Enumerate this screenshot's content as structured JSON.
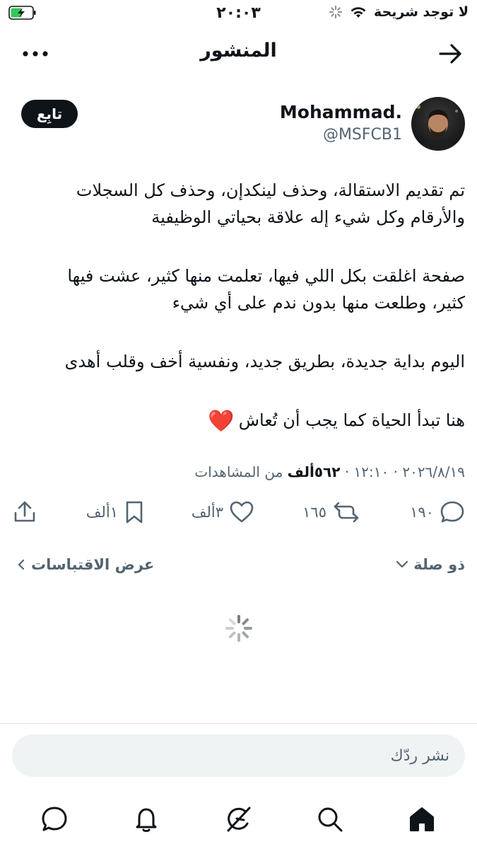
{
  "status_bar": {
    "time": "٢٠:٠٣",
    "carrier": "لا توجد شريحة",
    "icons": [
      "battery-charging-icon",
      "wifi-icon",
      "loading-icon"
    ]
  },
  "header": {
    "title": "المنشور",
    "back_icon": "arrow-icon",
    "more_icon": "more-icon"
  },
  "author": {
    "name": "Mohammad.",
    "handle": "@MSFCB1",
    "follow_label": "تابِع"
  },
  "tweet": {
    "line1": "تم تقديم الاستقالة، وحذف لينكدإن، وحذف كل السجلات",
    "line2": "والأرقام وكل شيء إله علاقة بحياتي الوظيفية",
    "line3": "صفحة اغلقت بكل اللي فيها، تعلمت منها كثير، عشت فيها",
    "line4": "كثير، وطلعت منها بدون ندم على أي شيء",
    "line5": "اليوم بداية جديدة، بطريق جديد، ونفسية أخف وقلب أهدى",
    "line6": "هنا تبدأ الحياة كما يجب أن تُعاش",
    "emoji": "❤️"
  },
  "meta": {
    "date": "٢٠٢٦/٨/١٩",
    "time": "١٢:١٠",
    "views_count": "٥٦٢ألف",
    "views_label": "من المشاهدات"
  },
  "actions": {
    "replies": "١٩٠",
    "reposts": "١٦٥",
    "likes": "٣ألف",
    "bookmarks": "١ألف"
  },
  "filters": {
    "reply_filter": "ذو صلة",
    "view_quotes": "عرض الاقتباسات"
  },
  "reply": {
    "placeholder": "نشر ردّك"
  },
  "tabbar": [
    "home-icon",
    "search-icon",
    "grok-icon",
    "notifications-icon",
    "messages-icon"
  ]
}
